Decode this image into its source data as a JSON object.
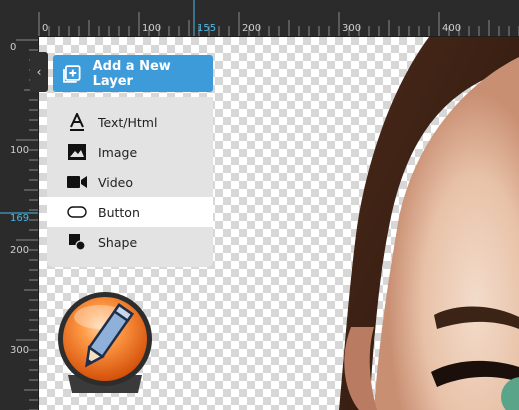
{
  "ruler": {
    "top_labels": [
      "0",
      "100",
      "155",
      "200",
      "300",
      "400"
    ],
    "left_labels": [
      "0",
      "100",
      "169",
      "200",
      "300"
    ],
    "highlight_x": "155",
    "highlight_y": "169"
  },
  "add_layer": {
    "label": "Add a New Layer"
  },
  "menu": {
    "items": [
      {
        "label": "Text/Html",
        "icon": "text-a-icon"
      },
      {
        "label": "Image",
        "icon": "image-icon"
      },
      {
        "label": "Video",
        "icon": "video-camera-icon"
      },
      {
        "label": "Button",
        "icon": "button-shape-icon",
        "active": true
      },
      {
        "label": "Shape",
        "icon": "shape-icon"
      }
    ]
  },
  "colors": {
    "accent": "#3d9bd9",
    "ruler_highlight": "#48b9e8",
    "menu_bg": "#e3e3e3",
    "menu_active_bg": "#ffffff"
  }
}
